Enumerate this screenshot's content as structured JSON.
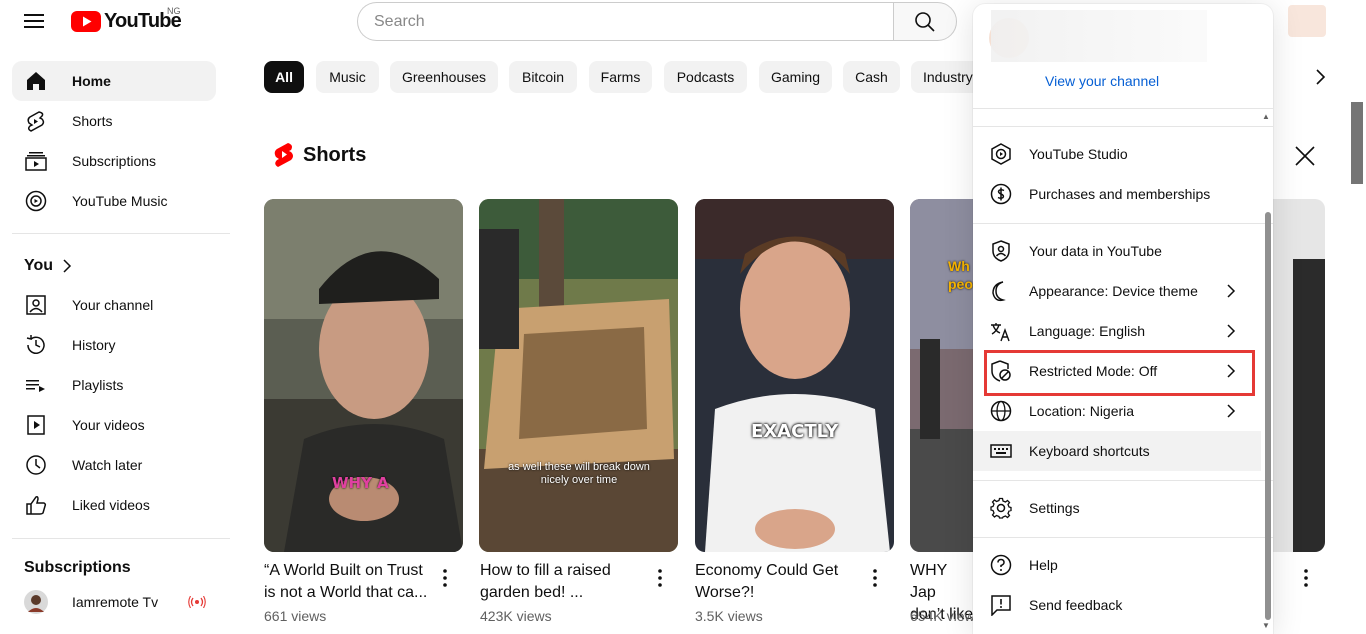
{
  "header": {
    "logo_text": "YouTube",
    "country_code": "NG",
    "search_placeholder": "Search"
  },
  "sidebar": {
    "main": [
      {
        "label": "Home",
        "icon": "home-icon",
        "active": true
      },
      {
        "label": "Shorts",
        "icon": "shorts-icon"
      },
      {
        "label": "Subscriptions",
        "icon": "subscriptions-icon"
      },
      {
        "label": "YouTube Music",
        "icon": "music-icon"
      }
    ],
    "you_title": "You",
    "you": [
      {
        "label": "Your channel",
        "icon": "channel-icon"
      },
      {
        "label": "History",
        "icon": "history-icon"
      },
      {
        "label": "Playlists",
        "icon": "playlists-icon"
      },
      {
        "label": "Your videos",
        "icon": "your-videos-icon"
      },
      {
        "label": "Watch later",
        "icon": "watch-later-icon"
      },
      {
        "label": "Liked videos",
        "icon": "like-icon"
      }
    ],
    "subs_title": "Subscriptions",
    "subs": [
      {
        "label": "Iamremote Tv",
        "live": true
      }
    ]
  },
  "chips": [
    "All",
    "Music",
    "Greenhouses",
    "Bitcoin",
    "Farms",
    "Podcasts",
    "Gaming",
    "Cash",
    "Industry"
  ],
  "shorts": {
    "title": "Shorts",
    "items": [
      {
        "title": "“A World Built on Trust is not a World that ca...",
        "views": "661 views",
        "caption": "WHY A"
      },
      {
        "title": "How to fill a raised garden bed! ...",
        "views": "423K views",
        "caption": "as well these will break down nicely over time"
      },
      {
        "title": "Economy Could Get Worse?!",
        "views": "3.5K views",
        "caption": "EXACTLY"
      },
      {
        "title": "WHY Jap don’t like",
        "views": "654K views",
        "caption": "Wh peo"
      }
    ]
  },
  "menu": {
    "view_channel": "View your channel",
    "items": [
      {
        "label": "YouTube Studio",
        "icon": "studio-icon"
      },
      {
        "label": "Purchases and memberships",
        "icon": "dollar-icon"
      },
      {
        "label": "Your data in YouTube",
        "icon": "data-shield-icon"
      },
      {
        "label": "Appearance: Device theme",
        "icon": "moon-icon",
        "chevron": true
      },
      {
        "label": "Language: English",
        "icon": "language-icon",
        "chevron": true
      },
      {
        "label": "Restricted Mode: Off",
        "icon": "restricted-icon",
        "chevron": true
      },
      {
        "label": "Location: Nigeria",
        "icon": "globe-icon",
        "chevron": true
      },
      {
        "label": "Keyboard shortcuts",
        "icon": "keyboard-icon"
      },
      {
        "label": "Settings",
        "icon": "settings-icon"
      },
      {
        "label": "Help",
        "icon": "help-icon"
      },
      {
        "label": "Send feedback",
        "icon": "feedback-icon"
      }
    ]
  },
  "colors": {
    "brand_red": "#ff0000",
    "link_blue": "#065fd4",
    "highlight_red": "#e53935"
  }
}
